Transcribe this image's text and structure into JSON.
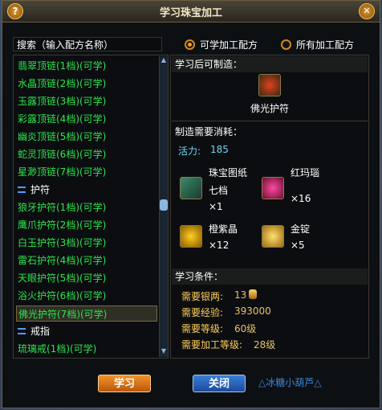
{
  "window": {
    "title": "学习珠宝加工"
  },
  "search": {
    "value": "搜索（输入配方名称）"
  },
  "filters": [
    {
      "label": "可学加工配方",
      "selected": true
    },
    {
      "label": "所有加工配方",
      "selected": false
    }
  ],
  "recipe_list": [
    {
      "type": "item",
      "label": "翡翠顶链(1档)(可学)"
    },
    {
      "type": "item",
      "label": "水晶顶链(2档)(可学)"
    },
    {
      "type": "item",
      "label": "玉露顶链(3档)(可学)"
    },
    {
      "type": "item",
      "label": "彩露顶链(4档)(可学)"
    },
    {
      "type": "item",
      "label": "幽炎顶链(5档)(可学)"
    },
    {
      "type": "item",
      "label": "蛇灵顶链(6档)(可学)"
    },
    {
      "type": "item",
      "label": "星渺顶链(7档)(可学)"
    },
    {
      "type": "category",
      "label": "护符"
    },
    {
      "type": "item",
      "label": "狼牙护符(1档)(可学)"
    },
    {
      "type": "item",
      "label": "鹰爪护符(2档)(可学)"
    },
    {
      "type": "item",
      "label": "白玉护符(3档)(可学)"
    },
    {
      "type": "item",
      "label": "雷石护符(4档)(可学)"
    },
    {
      "type": "item",
      "label": "天眼护符(5档)(可学)"
    },
    {
      "type": "item",
      "label": "浴火护符(6档)(可学)"
    },
    {
      "type": "item",
      "label": "佛光护符(7档)(可学)",
      "selected": true
    },
    {
      "type": "category",
      "label": "戒指"
    },
    {
      "type": "item",
      "label": "琉璃戒(1档)(可学)"
    }
  ],
  "detail": {
    "can_make_header": "学习后可制造：",
    "product_name": "佛光护符",
    "product_icon": "amulet-icon",
    "cost_header": "制造需要消耗：",
    "vitality_label": "活力:",
    "vitality_value": "185",
    "materials": [
      {
        "name": "珠宝图纸\n七档",
        "name_line1": "珠宝图纸",
        "name_line2": "七档",
        "qty": "×1",
        "icon": "scroll-icon"
      },
      {
        "name": "红玛瑙",
        "qty": "×16",
        "icon": "red-agate-icon"
      },
      {
        "name": "橙紫晶",
        "qty": "×12",
        "icon": "orange-crystal-icon"
      },
      {
        "name": "金锭",
        "qty": "×5",
        "icon": "gold-ingot-icon"
      }
    ],
    "req_header": "学习条件：",
    "requirements": [
      {
        "label": "需要银两:",
        "value": "13"
      },
      {
        "label": "需要经验:",
        "value": "393000"
      },
      {
        "label": "需要等级:",
        "value": "60级"
      },
      {
        "label": "需要加工等级:",
        "value": "28级"
      }
    ]
  },
  "buttons": {
    "learn": "学习",
    "close": "关闭"
  },
  "footer_text": "△冰糖小葫芦△",
  "colors": {
    "recipe_green": "#2ee54c",
    "accent_orange": "#f2922a",
    "req_label": "#ffcf5a"
  }
}
